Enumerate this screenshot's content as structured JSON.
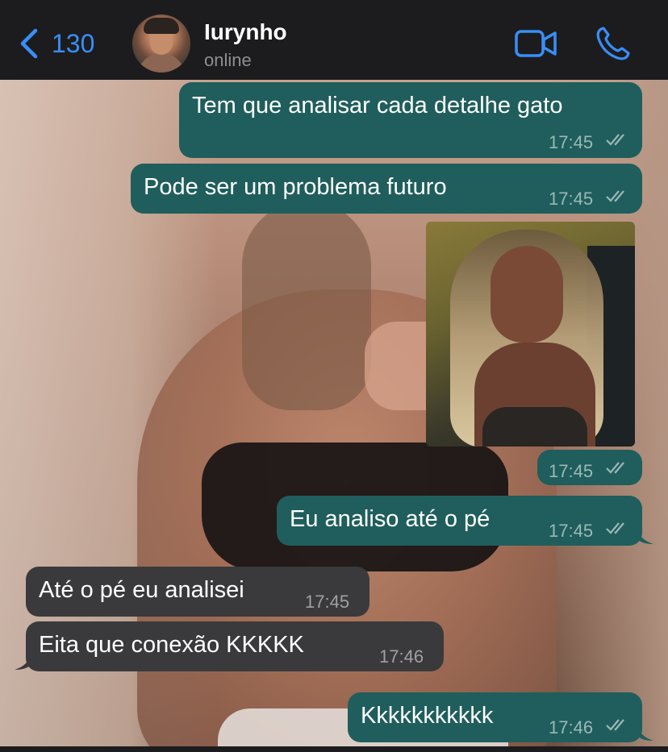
{
  "header": {
    "back_count": "130",
    "contact_name": "Iurynho",
    "status": "online",
    "icons": [
      "chevron-left-icon",
      "video-call-icon",
      "phone-icon"
    ]
  },
  "messages": [
    {
      "dir": "out",
      "text": "Tem que analisar cada detalhe gato",
      "time": "17:45",
      "read": true
    },
    {
      "dir": "out",
      "text": "Pode ser um problema futuro",
      "time": "17:45",
      "read": true
    },
    {
      "dir": "out",
      "type": "photo",
      "time": "17:45",
      "read": true
    },
    {
      "dir": "out",
      "text": "Eu analiso até o pé",
      "time": "17:45",
      "read": true
    },
    {
      "dir": "in",
      "text": "Até o pé eu analisei",
      "time": "17:45"
    },
    {
      "dir": "in",
      "text": "Eita que conexão KKKKK",
      "time": "17:46"
    },
    {
      "dir": "out",
      "text": "Kkkkkkkkkkk",
      "time": "17:46",
      "read": true
    }
  ],
  "colors": {
    "accent": "#3a8ef7",
    "outgoing_bubble": "#1f5e5c",
    "incoming_bubble": "#3a3a3c",
    "header_bg": "#1c1c1e",
    "read_ticks": "#9cb8b6"
  }
}
